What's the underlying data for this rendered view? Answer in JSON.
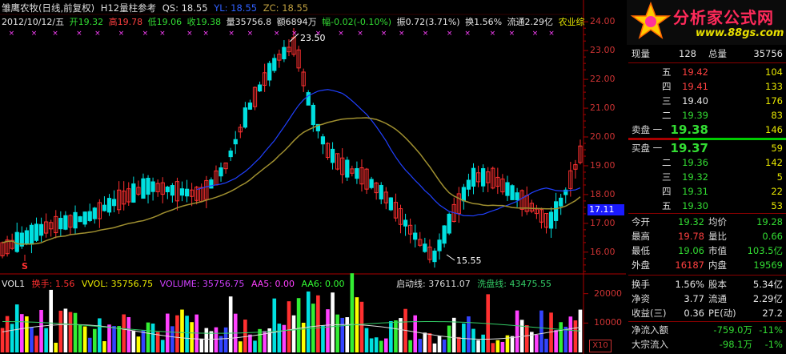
{
  "header": {
    "title": "雏鹰农牧(日线,前复权)",
    "indicator": "H12量柱参考",
    "qs": "QS: 18.55",
    "yl": "YL: 18.55",
    "zc": "ZC: 18.55"
  },
  "quote": {
    "date": "2012/10/12/五",
    "open": "开19.32",
    "high": "高19.78",
    "low": "低19.06",
    "close": "收19.38",
    "vol": "量35756.8",
    "amount": "额6894万",
    "change": "幅-0.02(-0.10%)",
    "amplitude": "振0.72(3.71%)",
    "turnover": "换1.56%",
    "float": "流通2.29亿",
    "sector": "农业综"
  },
  "annotations": {
    "high_mark": "23.50",
    "low_mark": "15.55",
    "s_mark": "S",
    "current_price": "17.11"
  },
  "axis": {
    "price_ticks": [
      "24.00",
      "23.00",
      "22.00",
      "21.00",
      "20.00",
      "19.00",
      "18.00",
      "17.00",
      "16.00"
    ],
    "vol_ticks": [
      "20000",
      "10000"
    ]
  },
  "volume_header": {
    "name": "VOL1",
    "huanshou": "换手: 1.56",
    "vvol": "VVOL: 35756.75",
    "volume": "VOLUME: 35756.75",
    "aa5": "AA5: 0.00",
    "aa6": "AA6: 0.00",
    "qidong": "启动线: 37611.07",
    "xipan": "洗盘线: 43475.55"
  },
  "x10_label": "X10",
  "logo": {
    "title": "分析家公式网",
    "url": "www.88gs.com"
  },
  "panel": {
    "xianliang_label": "现量",
    "xianliang": "128",
    "zongliang_label": "总量",
    "zongliang": "35756",
    "sell": [
      {
        "label": "五",
        "price": "19.42",
        "vol": "104"
      },
      {
        "label": "四",
        "price": "19.41",
        "vol": "133"
      },
      {
        "label": "三",
        "price": "19.40",
        "vol": "176"
      },
      {
        "label": "二",
        "price": "19.39",
        "vol": "83"
      },
      {
        "label": "卖盘  一",
        "price": "19.38",
        "vol": "146"
      }
    ],
    "buy": [
      {
        "label": "买盘  一",
        "price": "19.37",
        "vol": "59"
      },
      {
        "label": "二",
        "price": "19.36",
        "vol": "142"
      },
      {
        "label": "三",
        "price": "19.32",
        "vol": "5"
      },
      {
        "label": "四",
        "price": "19.31",
        "vol": "22"
      },
      {
        "label": "五",
        "price": "19.30",
        "vol": "53"
      }
    ],
    "stats": [
      {
        "l1": "今开",
        "v1": "19.32",
        "l2": "均价",
        "v2": "19.28"
      },
      {
        "l1": "最高",
        "v1": "19.78",
        "l2": "量比",
        "v2": "0.66"
      },
      {
        "l1": "最低",
        "v1": "19.06",
        "l2": "市值",
        "v2": "103.5亿"
      },
      {
        "l1": "外盘",
        "v1": "16187",
        "l2": "内盘",
        "v2": "19569"
      }
    ],
    "stats2": [
      {
        "l1": "换手",
        "v1": "1.56%",
        "l2": "股本",
        "v2": "5.34亿"
      },
      {
        "l1": "净资",
        "v1": "3.77",
        "l2": "流通",
        "v2": "2.29亿"
      },
      {
        "l1": "收益(三)",
        "v1": "0.36",
        "l2": "PE(动)",
        "v2": "27.2"
      }
    ],
    "flow": [
      {
        "label": "净流入额",
        "value": "-759.0万",
        "pct": "-11%"
      },
      {
        "label": "大宗流入",
        "value": "-98.1万",
        "pct": "-1%"
      }
    ]
  },
  "colors": {
    "up": "#ff3030",
    "down": "#00e0e0",
    "ma1": "#2040ff",
    "ma2": "#a09030"
  }
}
